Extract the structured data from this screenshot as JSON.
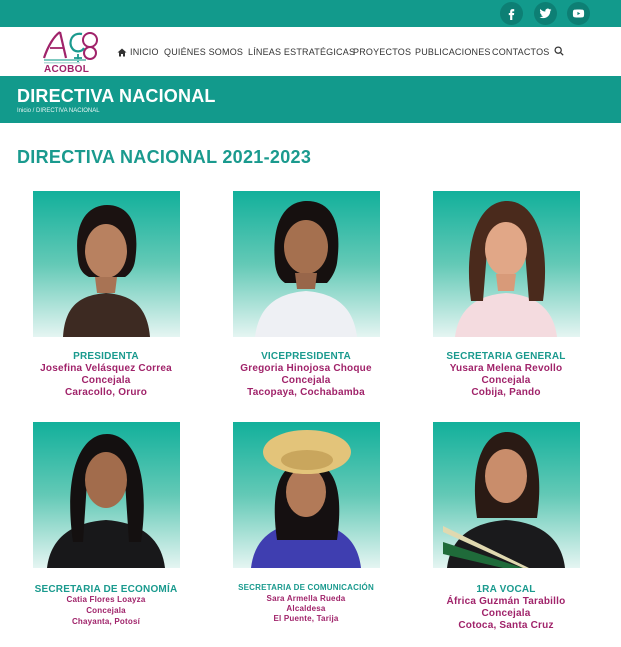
{
  "topbar": {
    "social": [
      {
        "name": "facebook-icon",
        "glyph": "f"
      },
      {
        "name": "twitter-icon",
        "glyph": "t"
      },
      {
        "name": "youtube-icon",
        "glyph": "y"
      }
    ]
  },
  "brand": {
    "logo_text": "ACOBOL"
  },
  "nav": {
    "home": "INICIO",
    "about": "QUIÉNES SOMOS",
    "lines": "LÍNEAS ESTRATÉGICAS",
    "projects": "PROYECTOS",
    "publications": "PUBLICACIONES",
    "contacts": "CONTACTOS"
  },
  "banner": {
    "title": "DIRECTIVA NACIONAL",
    "breadcrumb": "Inicio / DIRECTIVA NACIONAL"
  },
  "section": {
    "title": "DIRECTIVA NACIONAL 2021-2023"
  },
  "members": [
    {
      "role": "PRESIDENTA",
      "name": "Josefina Velásquez Correa",
      "title": "Concejala",
      "place": "Caracollo, Oruro"
    },
    {
      "role": "VICEPRESIDENTA",
      "name": "Gregoria Hinojosa Choque",
      "title": "Concejala",
      "place": "Tacopaya, Cochabamba"
    },
    {
      "role": "SECRETARIA GENERAL",
      "name": "Yusara Melena Revollo",
      "title": "Concejala",
      "place": "Cobija, Pando"
    },
    {
      "role": "SECRETARIA DE ECONOMÍA",
      "name": "Catia Flores Loayza",
      "title": "Concejala",
      "place": "Chayanta, Potosí"
    },
    {
      "role": "SECRETARIA DE COMUNICACIÓN",
      "name": "Sara Armella Rueda",
      "title": "Alcaldesa",
      "place": "El Puente, Tarija"
    },
    {
      "role": "1RA VOCAL",
      "name": "África Guzmán Tarabillo",
      "title": "Concejala",
      "place": "Cotoca, Santa Cruz"
    }
  ]
}
